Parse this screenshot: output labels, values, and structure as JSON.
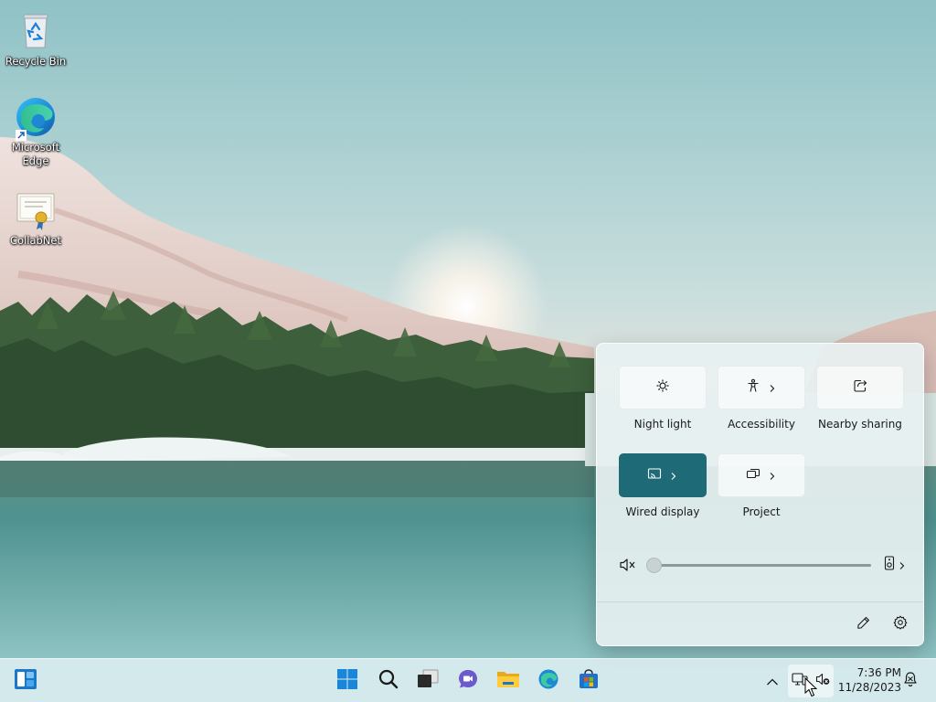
{
  "desktop": {
    "icons": [
      {
        "label": "Recycle Bin",
        "icon": "recycle-bin-icon"
      },
      {
        "label": "Microsoft Edge",
        "icon": "edge-icon"
      },
      {
        "label": "CollabNet",
        "icon": "certificate-icon"
      }
    ]
  },
  "quick_settings": {
    "tiles": [
      {
        "label": "Night light",
        "icon": "brightness-icon",
        "active": false,
        "has_chevron": false
      },
      {
        "label": "Accessibility",
        "icon": "accessibility-icon",
        "active": false,
        "has_chevron": true
      },
      {
        "label": "Nearby sharing",
        "icon": "share-icon",
        "active": false,
        "has_chevron": false
      },
      {
        "label": "Wired display",
        "icon": "cast-icon",
        "active": true,
        "has_chevron": true
      },
      {
        "label": "Project",
        "icon": "project-icon",
        "active": false,
        "has_chevron": true
      }
    ],
    "volume": {
      "level": 0,
      "muted": true,
      "output_icon": "speaker-icon"
    },
    "footer": {
      "edit_icon": "pencil-icon",
      "settings_icon": "gear-icon"
    }
  },
  "taskbar": {
    "widgets_icon": "widgets-icon",
    "pinned": [
      "windows-start-icon",
      "search-icon",
      "task-view-icon",
      "chat-icon",
      "file-explorer-icon",
      "edge-icon",
      "microsoft-store-icon"
    ],
    "tray": {
      "chevron": "chevron-up-icon",
      "network_icon": "network-icon",
      "volume_icon": "volume-muted-icon"
    },
    "clock": {
      "time": "7:36 PM",
      "date": "11/28/2023"
    },
    "notification_icon": "notification-bell-icon"
  },
  "colors": {
    "accent": "#1e6b77",
    "panel_bg": "#e8f1f1",
    "taskbar_bg": "#d6eaed"
  }
}
